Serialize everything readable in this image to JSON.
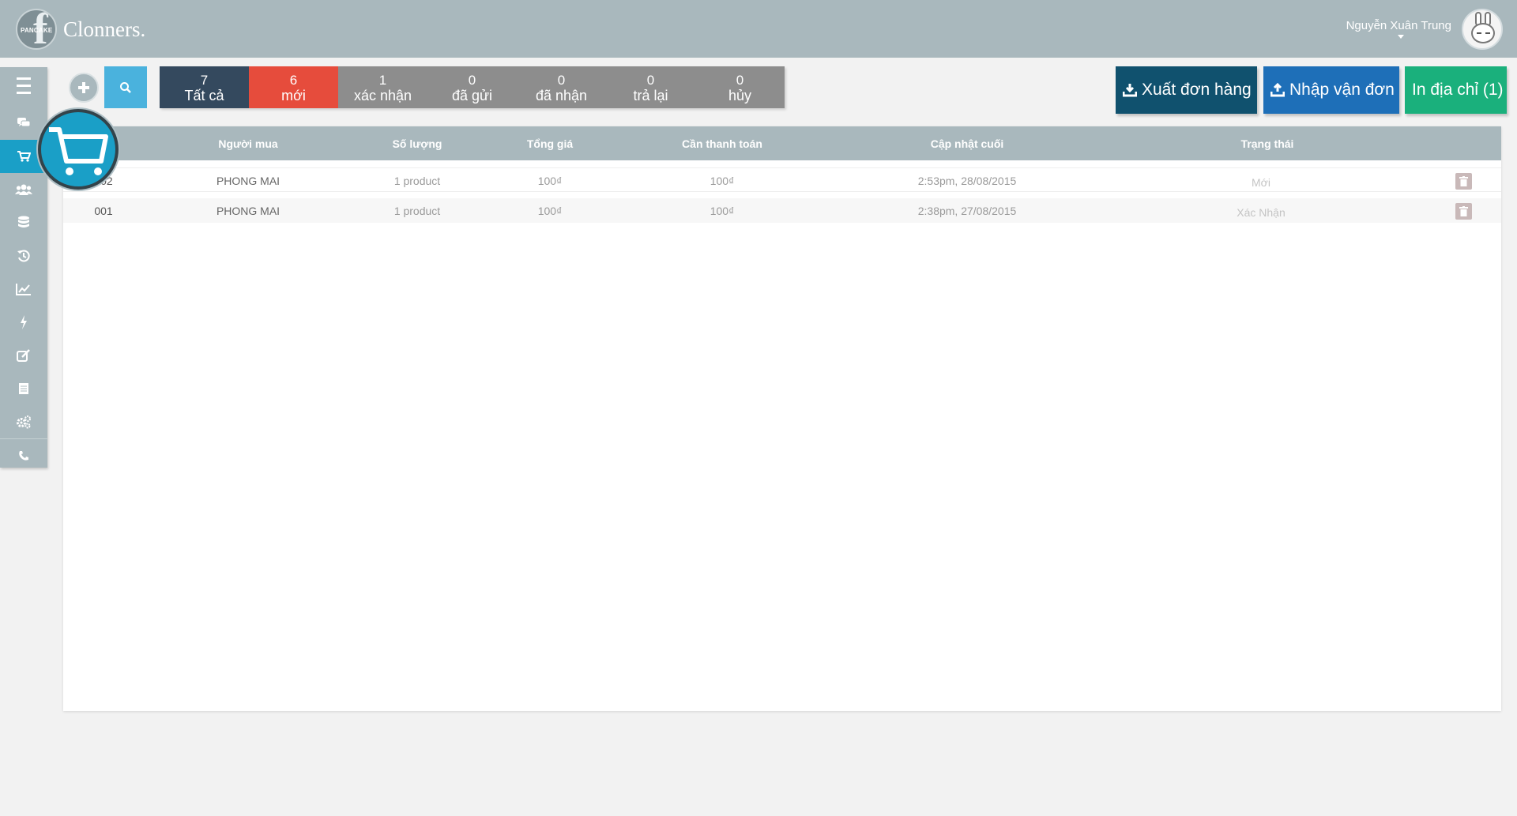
{
  "header": {
    "logo_small_text": "PANCAKE",
    "logo_letter": "f",
    "brand": "Clonners",
    "user_name": "Nguyễn Xuân Trung"
  },
  "sidebar": {
    "items": [
      {
        "name": "menu",
        "icon": "hamburger-icon"
      },
      {
        "name": "messages",
        "icon": "chat-icon"
      },
      {
        "name": "orders",
        "icon": "cart-icon",
        "active": true
      },
      {
        "name": "customers",
        "icon": "users-icon"
      },
      {
        "name": "database",
        "icon": "database-icon"
      },
      {
        "name": "history",
        "icon": "history-icon"
      },
      {
        "name": "statistics",
        "icon": "chart-icon"
      },
      {
        "name": "automation",
        "icon": "bolt-icon"
      },
      {
        "name": "edit",
        "icon": "edit-icon"
      },
      {
        "name": "list",
        "icon": "list-icon"
      },
      {
        "name": "settings",
        "icon": "gears-icon"
      },
      {
        "name": "phone",
        "icon": "phone-icon"
      }
    ]
  },
  "filters": [
    {
      "count": "7",
      "label": "Tất cả",
      "color": "#34495e"
    },
    {
      "count": "6",
      "label": "mới",
      "color": "#e64c3c"
    },
    {
      "count": "1",
      "label": "xác nhận",
      "color": "#8d8d8d"
    },
    {
      "count": "0",
      "label": "đã gửi",
      "color": "#8d8d8d"
    },
    {
      "count": "0",
      "label": "đã nhận",
      "color": "#8d8d8d"
    },
    {
      "count": "0",
      "label": "trả lại",
      "color": "#8d8d8d"
    },
    {
      "count": "0",
      "label": "hủy",
      "color": "#8d8d8d"
    }
  ],
  "actions": {
    "export_label": "Xuất đơn hàng",
    "import_label": "Nhập vận đơn",
    "print_label": "In địa chỉ (1)"
  },
  "table": {
    "columns": [
      "Người mua",
      "Số lượng",
      "Tổng giá",
      "Cần thanh toán",
      "Cập nhật cuối",
      "Trạng thái"
    ],
    "rows": [
      {
        "code": "002",
        "buyer": "PHONG MAI",
        "quantity": "1 product",
        "total": "100₫",
        "due": "100₫",
        "updated": "2:53pm, 28/08/2015",
        "status": "Mới"
      },
      {
        "code": "001",
        "buyer": "PHONG MAI",
        "quantity": "1 product",
        "total": "100₫",
        "due": "100₫",
        "updated": "2:38pm, 27/08/2015",
        "status": "Xác Nhận"
      }
    ]
  },
  "colors": {
    "topbar": "#a9b8bd",
    "accent_blue": "#1a9fc7",
    "search_blue": "#4ab2dd",
    "export": "#10516e",
    "import": "#1e6fb8",
    "print": "#1ab07c"
  }
}
